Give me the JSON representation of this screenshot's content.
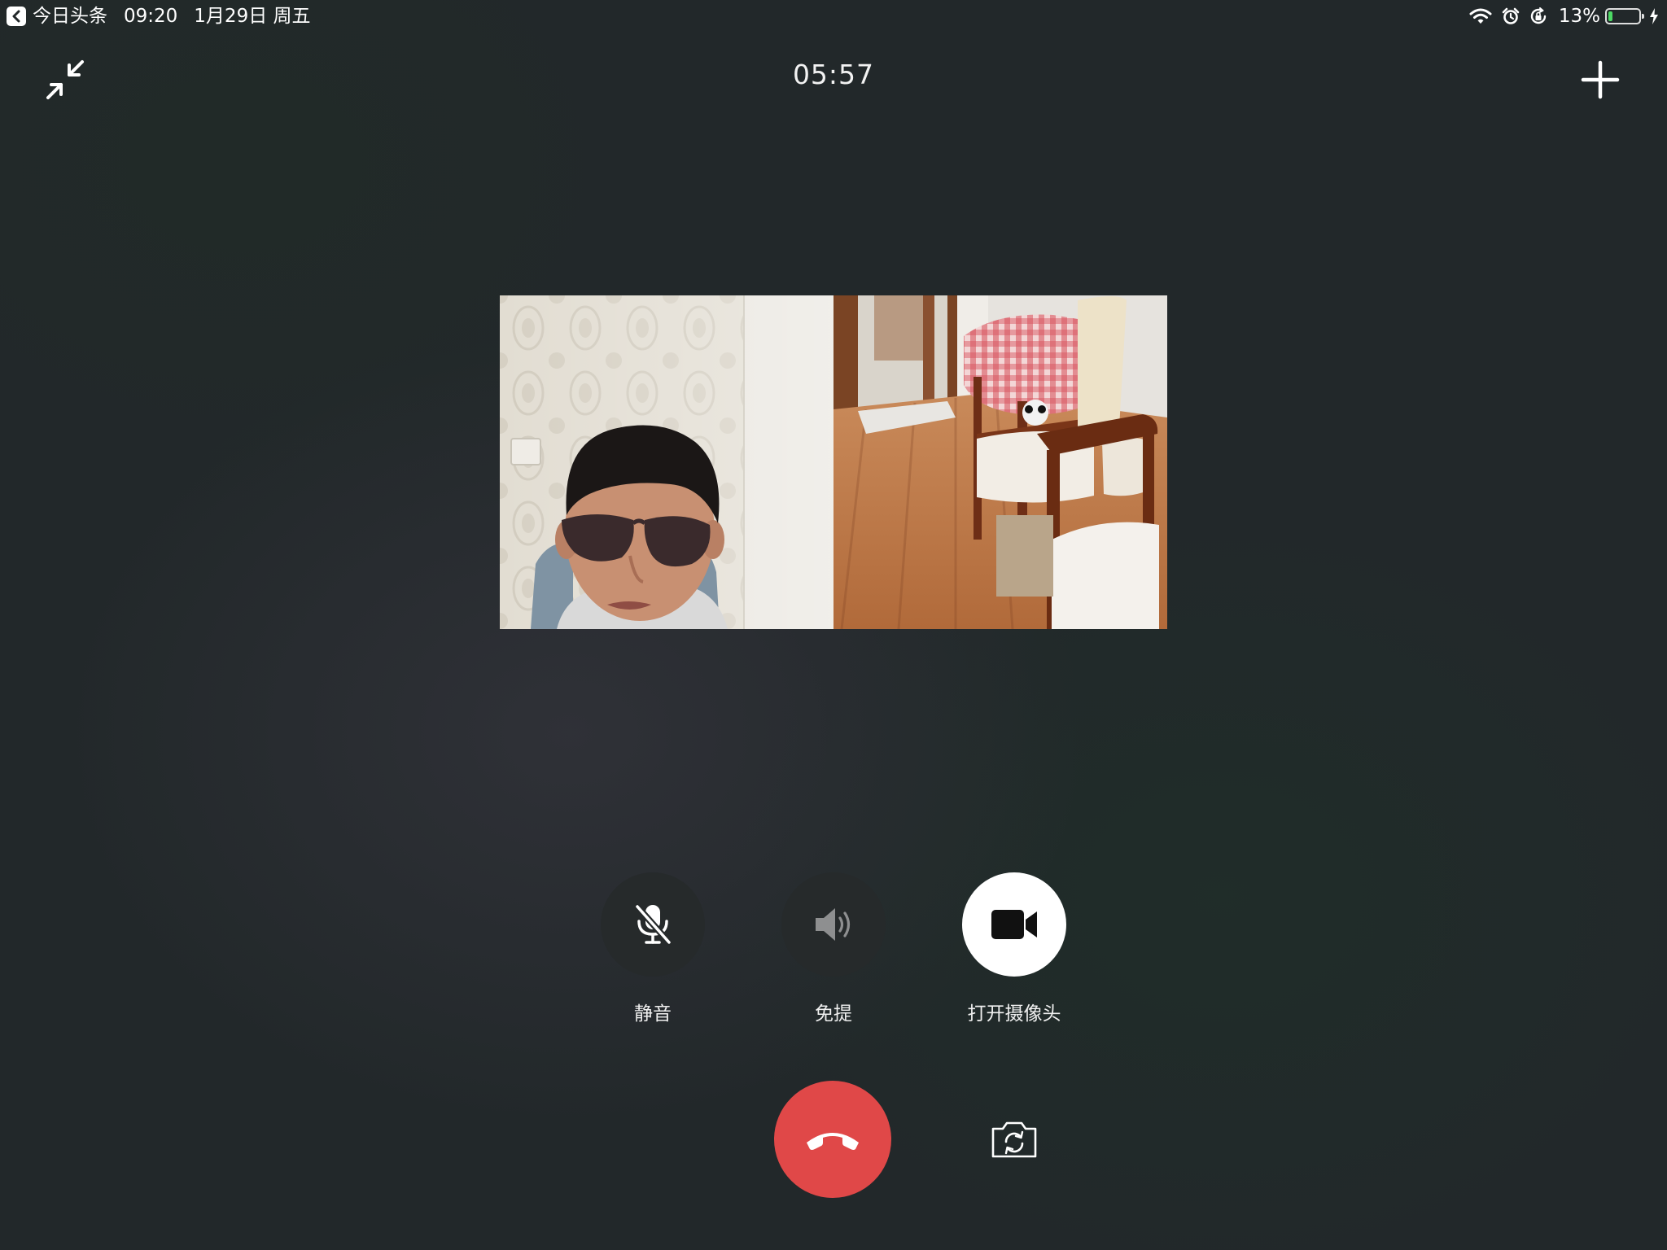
{
  "status_bar": {
    "back_app": "今日头条",
    "time": "09:20",
    "date": "1月29日 周五",
    "battery_text": "13%",
    "battery_level": 0.13,
    "icons": [
      "wifi-icon",
      "alarm-icon",
      "rotation-lock-icon",
      "battery-icon",
      "charging-icon"
    ]
  },
  "call": {
    "timer": "05:57"
  },
  "top_bar": {
    "minimize_icon": "minimize-arrows-icon",
    "add_icon": "plus-icon"
  },
  "videos": [
    {
      "name": "participant-video-1",
      "description_icon": "person-video"
    },
    {
      "name": "participant-video-2",
      "description_icon": "room-video"
    }
  ],
  "controls": {
    "mute_label": "静音",
    "speaker_label": "免提",
    "camera_label": "打开摄像头"
  },
  "actions": {
    "hangup_icon": "phone-hangup-icon",
    "flip_icon": "flip-camera-icon"
  },
  "colors": {
    "hangup": "#e04848",
    "battery_fill": "#4cd964",
    "background": "#22282a"
  }
}
